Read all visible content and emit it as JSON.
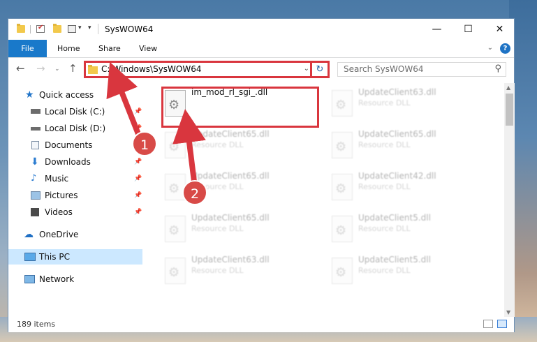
{
  "window": {
    "title": "SysWOW64"
  },
  "ribbon": {
    "file": "File",
    "home": "Home",
    "share": "Share",
    "view": "View",
    "help": "?"
  },
  "nav": {
    "back": "←",
    "forward": "→",
    "recent": "⌄",
    "up": "↑",
    "address": "C:\\Windows\\SysWOW64",
    "search_placeholder": "Search SysWOW64"
  },
  "sidebar": {
    "items": [
      {
        "label": "Quick access",
        "icon": "star-icon"
      },
      {
        "label": "Local Disk (C:)",
        "icon": "drive-icon"
      },
      {
        "label": "Local Disk (D:)",
        "icon": "drive-icon"
      },
      {
        "label": "Documents",
        "icon": "documents-icon"
      },
      {
        "label": "Downloads",
        "icon": "downloads-icon"
      },
      {
        "label": "Music",
        "icon": "music-icon"
      },
      {
        "label": "Pictures",
        "icon": "pictures-icon"
      },
      {
        "label": "Videos",
        "icon": "videos-icon"
      },
      {
        "label": "OneDrive",
        "icon": "cloud-icon"
      },
      {
        "label": "This PC",
        "icon": "computer-icon"
      },
      {
        "label": "Network",
        "icon": "network-icon"
      }
    ]
  },
  "files": [
    {
      "name": "im_mod_rl_sgi_.dll",
      "type": ""
    },
    {
      "name": "UpdateClient63.dll",
      "type": "Resource DLL"
    },
    {
      "name": "UpdateClient65.dll",
      "type": "Resource DLL"
    },
    {
      "name": "UpdateClient65.dll",
      "type": "Resource DLL"
    },
    {
      "name": "UpdateClient65.dll",
      "type": "Resource DLL"
    },
    {
      "name": "UpdateClient42.dll",
      "type": "Resource DLL"
    },
    {
      "name": "UpdateClient65.dll",
      "type": "Resource DLL"
    },
    {
      "name": "UpdateClient5.dll",
      "type": "Resource DLL"
    },
    {
      "name": "UpdateClient63.dll",
      "type": "Resource DLL"
    },
    {
      "name": "UpdateClient5.dll",
      "type": "Resource DLL"
    }
  ],
  "status": {
    "count": "189 items"
  },
  "annotations": {
    "step1": "1",
    "step2": "2",
    "color": "#d9363e"
  }
}
